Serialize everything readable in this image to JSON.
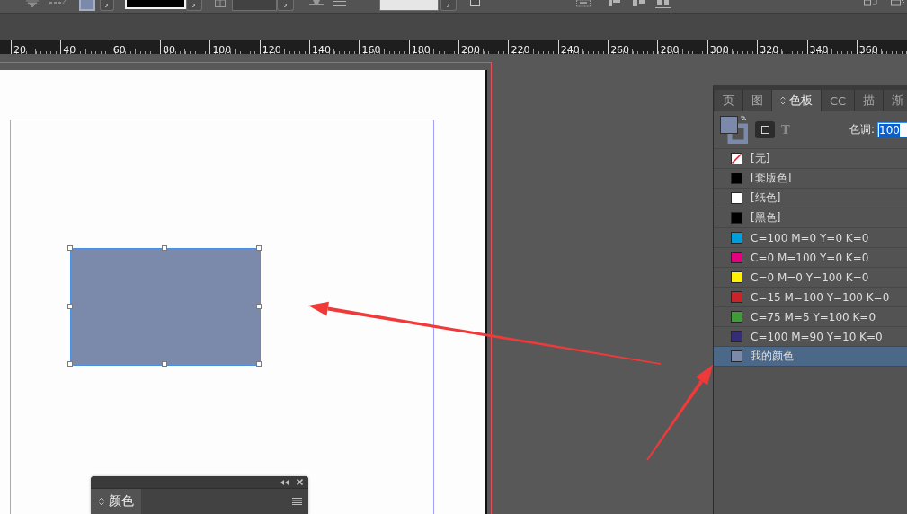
{
  "toolbar": {
    "checkbox": {
      "checked": false
    }
  },
  "ruler": {
    "labels": [
      "20",
      "40",
      "60",
      "80",
      "100",
      "120",
      "140",
      "160",
      "180",
      "200",
      "220",
      "240",
      "260",
      "280",
      "300",
      "320",
      "340",
      "360"
    ]
  },
  "document": {
    "rectangle": {
      "selected": true
    }
  },
  "swatches_panel": {
    "tabs": [
      {
        "label": "页",
        "selected": false
      },
      {
        "label": "图",
        "selected": false
      },
      {
        "label": "色板",
        "selected": true
      },
      {
        "label": "CC",
        "selected": false
      },
      {
        "label": "描",
        "selected": false
      },
      {
        "label": "渐",
        "selected": false
      }
    ],
    "text_toggle": "T",
    "tint": {
      "label": "色调:",
      "value": "100"
    },
    "swatches": [
      {
        "name": "[无]",
        "kind": "none",
        "selected": false
      },
      {
        "name": "[套版色]",
        "kind": "color",
        "color": "#000000",
        "selected": false
      },
      {
        "name": "[纸色]",
        "kind": "color",
        "color": "#ffffff",
        "selected": false
      },
      {
        "name": "[黑色]",
        "kind": "color",
        "color": "#000000",
        "selected": false
      },
      {
        "name": "C=100 M=0 Y=0 K=0",
        "kind": "color",
        "color": "#009ddc",
        "selected": false
      },
      {
        "name": "C=0 M=100 Y=0 K=0",
        "kind": "color",
        "color": "#e4007f",
        "selected": false
      },
      {
        "name": "C=0 M=0 Y=100 K=0",
        "kind": "color",
        "color": "#fff100",
        "selected": false
      },
      {
        "name": "C=15 M=100 Y=100 K=0",
        "kind": "color",
        "color": "#c9242a",
        "selected": false
      },
      {
        "name": "C=75 M=5 Y=100 K=0",
        "kind": "color",
        "color": "#3f9c36",
        "selected": false
      },
      {
        "name": "C=100 M=90 Y=10 K=0",
        "kind": "color",
        "color": "#352d75",
        "selected": false
      },
      {
        "name": "我的颜色",
        "kind": "color",
        "color": "#7b8aaa",
        "selected": true
      }
    ]
  },
  "color_panel": {
    "tabs": [
      {
        "label": "颜色",
        "selected": true
      }
    ]
  }
}
